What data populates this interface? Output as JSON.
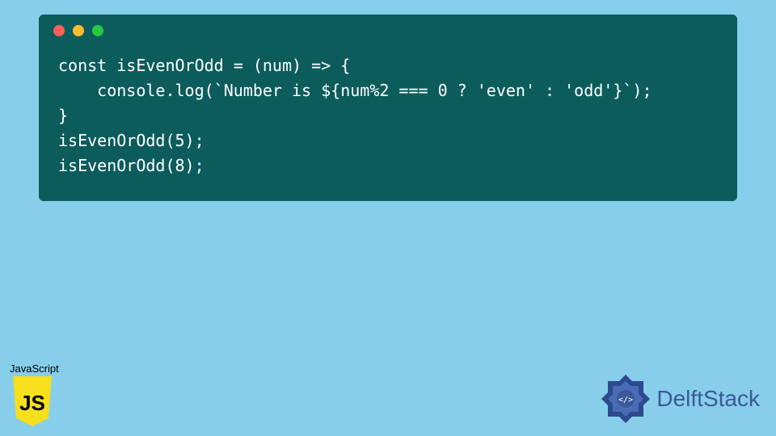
{
  "code_lines": [
    "const isEvenOrOdd = (num) => {",
    "    console.log(`Number is ${num%2 === 0 ? 'even' : 'odd'}`);",
    "}",
    "isEvenOrOdd(5);",
    "isEvenOrOdd(8);"
  ],
  "js_badge": {
    "label": "JavaScript",
    "shield_text": "JS"
  },
  "brand": {
    "name": "DelftStack"
  },
  "colors": {
    "page_bg": "#87ceeb",
    "window_bg": "#0d5c5c",
    "code_fg": "#ffffff",
    "js_shield": "#f7df1e",
    "brand_primary": "#3b5998"
  }
}
